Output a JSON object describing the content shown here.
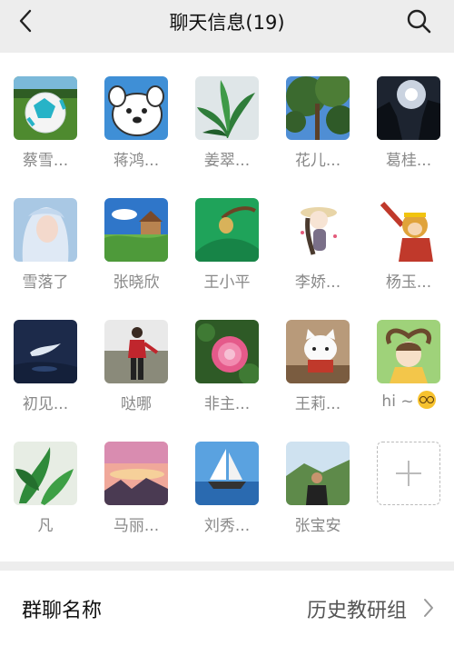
{
  "header": {
    "title": "聊天信息(19)"
  },
  "members": [
    {
      "name": "蔡雪...",
      "icon": "avatar-soccer-ball"
    },
    {
      "name": "蒋鸿...",
      "icon": "avatar-cartoon-dog"
    },
    {
      "name": "姜翠...",
      "icon": "avatar-green-plant"
    },
    {
      "name": "花儿...",
      "icon": "avatar-tree-sky"
    },
    {
      "name": "葛桂...",
      "icon": "avatar-rock-sunlight"
    },
    {
      "name": "雪落了",
      "icon": "avatar-elf-girl"
    },
    {
      "name": "张晓欣",
      "icon": "avatar-landscape-house"
    },
    {
      "name": "王小平",
      "icon": "avatar-green-sphere"
    },
    {
      "name": "李娇...",
      "icon": "avatar-girl-hat"
    },
    {
      "name": "杨玉...",
      "icon": "avatar-monkey-king"
    },
    {
      "name": "初见...",
      "icon": "avatar-bird-dark"
    },
    {
      "name": "哒哪",
      "icon": "avatar-woman-red"
    },
    {
      "name": "非主...",
      "icon": "avatar-pink-flower"
    },
    {
      "name": "王莉...",
      "icon": "avatar-hello-kitty"
    },
    {
      "name": "hi ~",
      "icon": "avatar-girl-heart",
      "emoji": "nerd-face-emoji"
    },
    {
      "name": "凡",
      "icon": "avatar-green-leaves"
    },
    {
      "name": "马丽...",
      "icon": "avatar-sunset-clouds"
    },
    {
      "name": "刘秀...",
      "icon": "avatar-sailboat"
    },
    {
      "name": "张宝安",
      "icon": "avatar-man-mountain"
    }
  ],
  "add_member": {
    "icon": "plus-icon"
  },
  "group_name_row": {
    "label": "群聊名称",
    "value": "历史教研组"
  }
}
